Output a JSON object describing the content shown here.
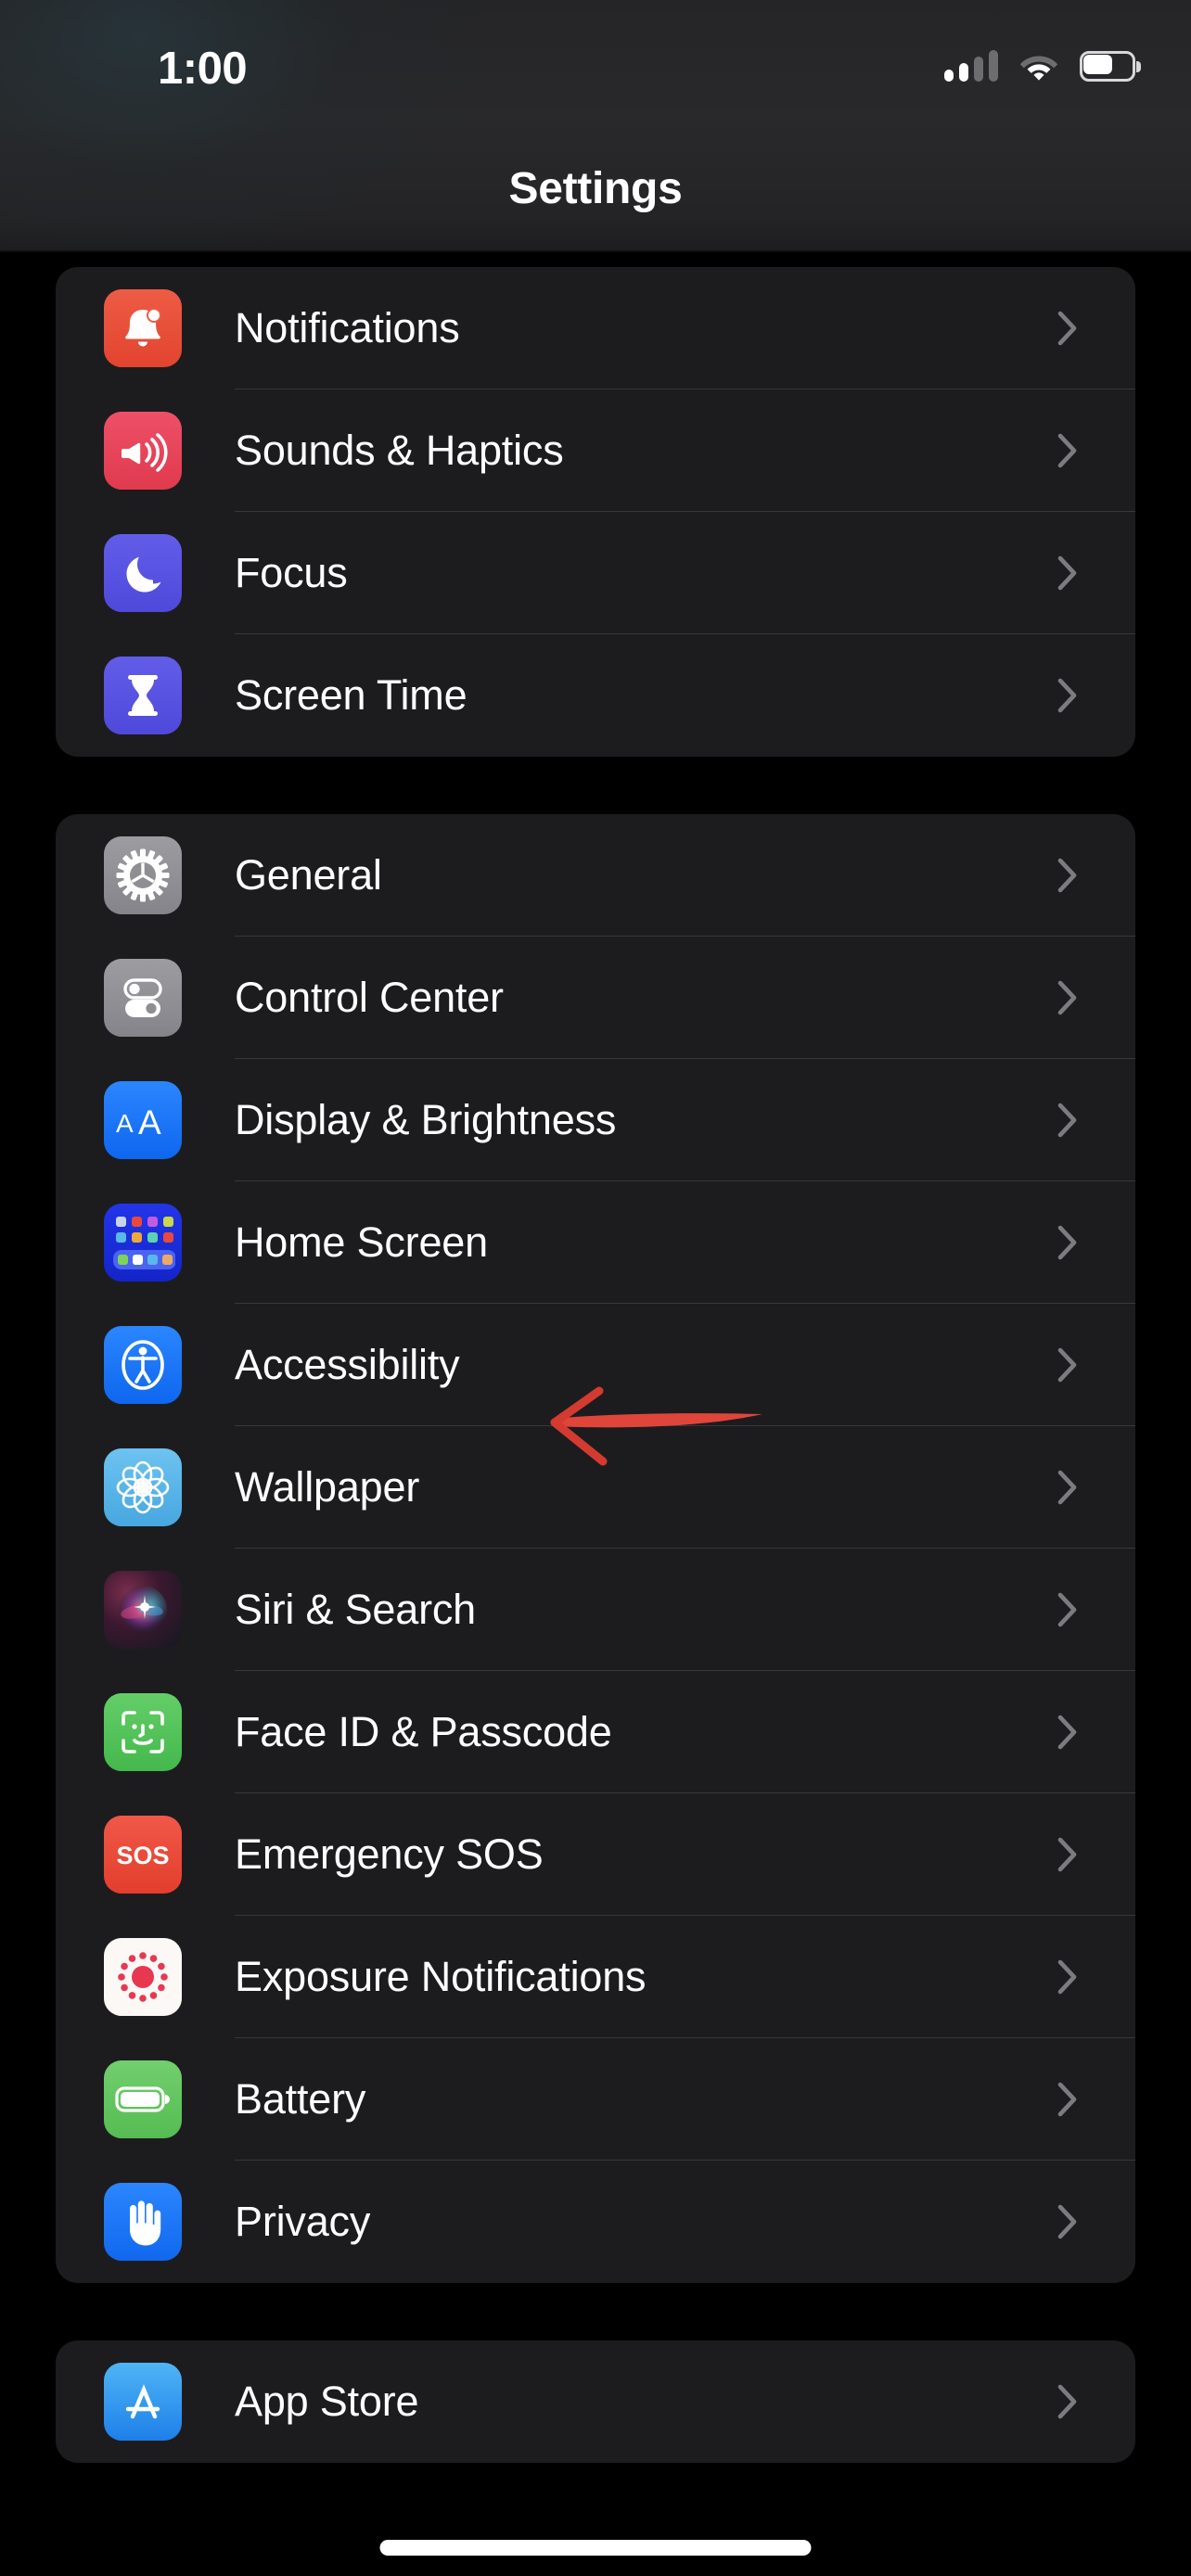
{
  "status_bar": {
    "time": "1:00",
    "cellular_icon": "cellular-signal-icon",
    "cellular_bars_filled": 2,
    "cellular_bars_total": 4,
    "wifi_icon": "wifi-icon",
    "wifi_strength": "full",
    "battery_icon": "battery-icon",
    "battery_percent": 60
  },
  "nav": {
    "title": "Settings"
  },
  "groups": [
    {
      "id": "group-notifications",
      "rows": [
        {
          "label": "Notifications",
          "icon": "bell-icon",
          "chevron": "chevron-right-icon"
        },
        {
          "label": "Sounds & Haptics",
          "icon": "speaker-waves-icon",
          "chevron": "chevron-right-icon"
        },
        {
          "label": "Focus",
          "icon": "moon-icon",
          "chevron": "chevron-right-icon"
        },
        {
          "label": "Screen Time",
          "icon": "hourglass-icon",
          "chevron": "chevron-right-icon"
        }
      ]
    },
    {
      "id": "group-general",
      "rows": [
        {
          "label": "General",
          "icon": "gear-icon",
          "chevron": "chevron-right-icon"
        },
        {
          "label": "Control Center",
          "icon": "sliders-toggle-icon",
          "chevron": "chevron-right-icon"
        },
        {
          "label": "Display & Brightness",
          "icon": "aa-text-size-icon",
          "chevron": "chevron-right-icon"
        },
        {
          "label": "Home Screen",
          "icon": "app-grid-icon",
          "chevron": "chevron-right-icon"
        },
        {
          "label": "Accessibility",
          "icon": "accessibility-person-icon",
          "chevron": "chevron-right-icon"
        },
        {
          "label": "Wallpaper",
          "icon": "flower-icon",
          "chevron": "chevron-right-icon"
        },
        {
          "label": "Siri & Search",
          "icon": "siri-orb-icon",
          "chevron": "chevron-right-icon"
        },
        {
          "label": "Face ID & Passcode",
          "icon": "face-id-icon",
          "chevron": "chevron-right-icon"
        },
        {
          "label": "Emergency SOS",
          "icon": "sos-icon",
          "chevron": "chevron-right-icon"
        },
        {
          "label": "Exposure Notifications",
          "icon": "exposure-dots-icon",
          "chevron": "chevron-right-icon"
        },
        {
          "label": "Battery",
          "icon": "battery-full-icon",
          "chevron": "chevron-right-icon"
        },
        {
          "label": "Privacy",
          "icon": "hand-raised-icon",
          "chevron": "chevron-right-icon"
        }
      ]
    },
    {
      "id": "group-store",
      "rows": [
        {
          "label": "App Store",
          "icon": "app-store-icon",
          "chevron": "chevron-right-icon"
        }
      ]
    }
  ],
  "annotation": {
    "type": "hand-drawn-arrow",
    "direction": "left",
    "color": "#E0453A",
    "points_to": "Accessibility"
  },
  "home_indicator": {
    "icon": "home-indicator"
  },
  "colors": {
    "page_background": "#000000",
    "card_background": "#1C1C1E",
    "separator": "#38383A",
    "primary_text": "#FFFFFF",
    "chevron": "#7C7C80",
    "annotation_red": "#E0453A",
    "icon_notifications": "#E8503A",
    "icon_sounds": "#E8435A",
    "icon_focus": "#5B56E0",
    "icon_screen_time": "#5B56E0",
    "icon_general": "#8E8E93",
    "icon_control_center": "#8E8E93",
    "icon_display": "#1573F0",
    "icon_home_screen": "#1D32D8",
    "icon_accessibility": "#1573F0",
    "icon_wallpaper": "#5AB4E8",
    "icon_face_id": "#56C45C",
    "icon_sos": "#EE4A3C",
    "icon_exposure": "#FFFFFF",
    "icon_battery": "#68C martin",
    "icon_privacy": "#1573F0"
  }
}
